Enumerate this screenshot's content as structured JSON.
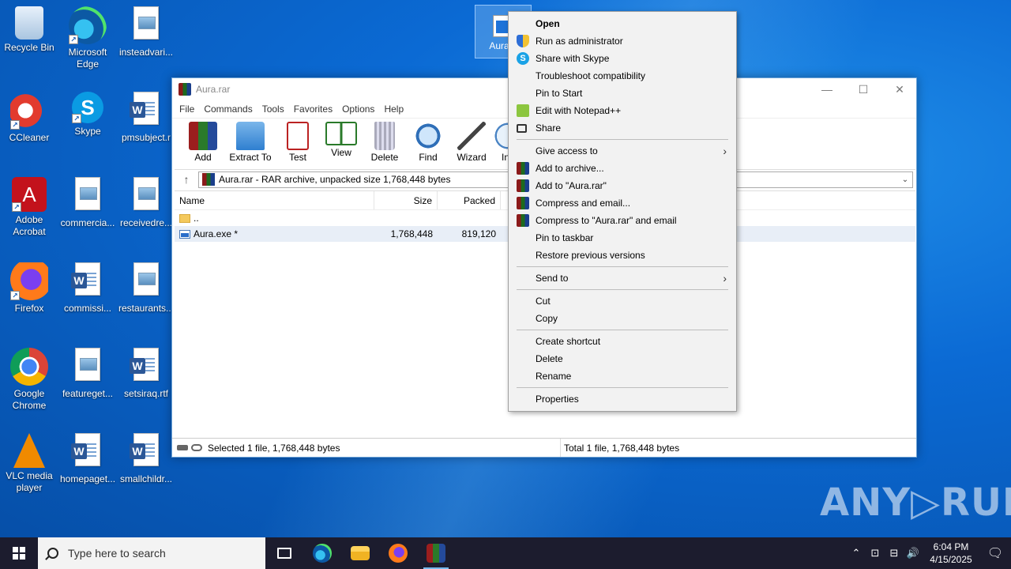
{
  "desktop": {
    "icons": [
      {
        "label": "Recycle Bin"
      },
      {
        "label": "Microsoft Edge"
      },
      {
        "label": "insteadvari..."
      },
      {
        "label": "CCleaner"
      },
      {
        "label": "Skype"
      },
      {
        "label": "pmsubject.r"
      },
      {
        "label": "Adobe Acrobat"
      },
      {
        "label": "commercia..."
      },
      {
        "label": "receivedre..."
      },
      {
        "label": "Firefox"
      },
      {
        "label": "commissi..."
      },
      {
        "label": "restaurants..."
      },
      {
        "label": "Google Chrome"
      },
      {
        "label": "featureget..."
      },
      {
        "label": "setsiraq.rtf"
      },
      {
        "label": "VLC media player"
      },
      {
        "label": "homepaget..."
      },
      {
        "label": "smallchildr..."
      }
    ],
    "selected_file": {
      "label": "Aura.e"
    }
  },
  "winrar": {
    "title": "Aura.rar",
    "controls": {
      "minimize": "—",
      "maximize": "☐",
      "close": "✕"
    },
    "menu": [
      "File",
      "Commands",
      "Tools",
      "Favorites",
      "Options",
      "Help"
    ],
    "toolbar": [
      "Add",
      "Extract To",
      "Test",
      "View",
      "Delete",
      "Find",
      "Wizard",
      "In"
    ],
    "address": {
      "up": "↑",
      "path": "Aura.rar - RAR archive, unpacked size 1,768,448 bytes",
      "dropdown": "⌄"
    },
    "columns": {
      "name": "Name",
      "size": "Size",
      "packed": "Packed"
    },
    "rows": [
      {
        "name": "..",
        "size": "",
        "packed": ""
      },
      {
        "name": "Aura.exe *",
        "size": "1,768,448",
        "packed": "819,120"
      }
    ],
    "status": {
      "left": "Selected 1 file, 1,768,448 bytes",
      "right": "Total 1 file, 1,768,448 bytes"
    }
  },
  "context_menu": {
    "groups": [
      [
        "Open",
        "Run as administrator",
        "Share with Skype",
        "Troubleshoot compatibility",
        "Pin to Start",
        "Edit with Notepad++",
        "Share"
      ],
      [
        "Give access to",
        "Add to archive...",
        "Add to \"Aura.rar\"",
        "Compress and email...",
        "Compress to \"Aura.rar\" and email",
        "Pin to taskbar",
        "Restore previous versions"
      ],
      [
        "Send to"
      ],
      [
        "Cut",
        "Copy"
      ],
      [
        "Create shortcut",
        "Delete",
        "Rename"
      ],
      [
        "Properties"
      ]
    ],
    "submenu_arrow": "›"
  },
  "watermark": "ANY▷RUN",
  "taskbar": {
    "search_placeholder": "Type here to search",
    "time": "6:04 PM",
    "date": "4/15/2025",
    "tray": {
      "chevron": "⌃",
      "meet": "⊡",
      "network": "⊟",
      "volume": "🔊",
      "notifications": "🗨"
    }
  },
  "colors": {
    "desktop": "#0a63c9",
    "taskbar": "#1c1c2e",
    "menu_bg": "#f2f2f2"
  }
}
